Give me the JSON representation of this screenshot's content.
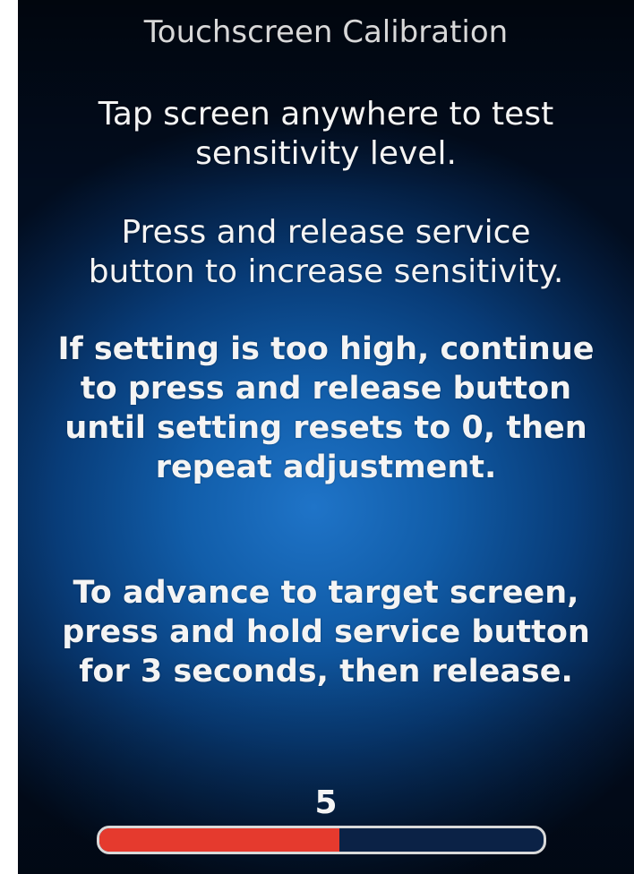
{
  "screen": {
    "title": "Touchscreen Calibration",
    "paragraphs": [
      "Tap screen anywhere to test\nsensitivity level.",
      "Press and release service\nbutton to increase sensitivity.",
      "If setting is too high, continue\nto press and release button\nuntil setting resets to 0, then\nrepeat adjustment.",
      "To advance to target screen,\npress and hold service button\nfor 3 seconds, then release."
    ],
    "sensitivity_level": "5",
    "sensitivity_fill_fraction": 0.54
  },
  "colors": {
    "bar_fill": "#e53a2e",
    "bar_border": "#d9d9d9",
    "background_center": "#1f74c8"
  }
}
